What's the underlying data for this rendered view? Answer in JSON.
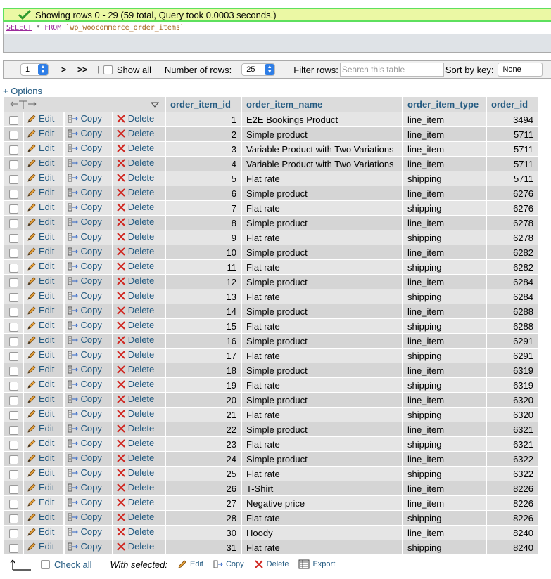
{
  "message": {
    "text": "Showing rows 0 - 29 (59 total, Query took 0.0003 seconds.)",
    "icon": "check-icon",
    "color": "#5ee05e"
  },
  "sql": {
    "select": "SELECT",
    "star": "*",
    "from": "FROM",
    "table": "`wp_woocommerce_order_items`"
  },
  "nav": {
    "page_value": "1",
    "next_label": ">",
    "last_label": ">>",
    "separator": "|",
    "show_all_label": "Show all",
    "rows_label": "Number of rows:",
    "rows_value": "25",
    "filter_label": "Filter rows:",
    "filter_placeholder": "Search this table",
    "sort_label": "Sort by key:",
    "sort_value": "None"
  },
  "options_label": "+ Options",
  "table": {
    "columns": [
      "order_item_id",
      "order_item_name",
      "order_item_type",
      "order_id"
    ],
    "action_labels": {
      "edit": "Edit",
      "copy": "Copy",
      "delete": "Delete"
    },
    "rows": [
      {
        "id": "1",
        "name": "E2E Bookings Product",
        "type": "line_item",
        "order": "3494"
      },
      {
        "id": "2",
        "name": "Simple product",
        "type": "line_item",
        "order": "5711"
      },
      {
        "id": "3",
        "name": "Variable Product with Two Variations",
        "type": "line_item",
        "order": "5711"
      },
      {
        "id": "4",
        "name": "Variable Product with Two Variations",
        "type": "line_item",
        "order": "5711"
      },
      {
        "id": "5",
        "name": "Flat rate",
        "type": "shipping",
        "order": "5711"
      },
      {
        "id": "6",
        "name": "Simple product",
        "type": "line_item",
        "order": "6276"
      },
      {
        "id": "7",
        "name": "Flat rate",
        "type": "shipping",
        "order": "6276"
      },
      {
        "id": "8",
        "name": "Simple product",
        "type": "line_item",
        "order": "6278"
      },
      {
        "id": "9",
        "name": "Flat rate",
        "type": "shipping",
        "order": "6278"
      },
      {
        "id": "10",
        "name": "Simple product",
        "type": "line_item",
        "order": "6282"
      },
      {
        "id": "11",
        "name": "Flat rate",
        "type": "shipping",
        "order": "6282"
      },
      {
        "id": "12",
        "name": "Simple product",
        "type": "line_item",
        "order": "6284"
      },
      {
        "id": "13",
        "name": "Flat rate",
        "type": "shipping",
        "order": "6284"
      },
      {
        "id": "14",
        "name": "Simple product",
        "type": "line_item",
        "order": "6288"
      },
      {
        "id": "15",
        "name": "Flat rate",
        "type": "shipping",
        "order": "6288"
      },
      {
        "id": "16",
        "name": "Simple product",
        "type": "line_item",
        "order": "6291"
      },
      {
        "id": "17",
        "name": "Flat rate",
        "type": "shipping",
        "order": "6291"
      },
      {
        "id": "18",
        "name": "Simple product",
        "type": "line_item",
        "order": "6319"
      },
      {
        "id": "19",
        "name": "Flat rate",
        "type": "shipping",
        "order": "6319"
      },
      {
        "id": "20",
        "name": "Simple product",
        "type": "line_item",
        "order": "6320"
      },
      {
        "id": "21",
        "name": "Flat rate",
        "type": "shipping",
        "order": "6320"
      },
      {
        "id": "22",
        "name": "Simple product",
        "type": "line_item",
        "order": "6321"
      },
      {
        "id": "23",
        "name": "Flat rate",
        "type": "shipping",
        "order": "6321"
      },
      {
        "id": "24",
        "name": "Simple product",
        "type": "line_item",
        "order": "6322"
      },
      {
        "id": "25",
        "name": "Flat rate",
        "type": "shipping",
        "order": "6322"
      },
      {
        "id": "26",
        "name": "T-Shirt",
        "type": "line_item",
        "order": "8226"
      },
      {
        "id": "27",
        "name": "Negative price",
        "type": "line_item",
        "order": "8226"
      },
      {
        "id": "28",
        "name": "Flat rate",
        "type": "shipping",
        "order": "8226"
      },
      {
        "id": "30",
        "name": "Hoody",
        "type": "line_item",
        "order": "8240"
      },
      {
        "id": "31",
        "name": "Flat rate",
        "type": "shipping",
        "order": "8240"
      }
    ]
  },
  "bottom": {
    "check_all_label": "Check all",
    "with_selected_label": "With selected:",
    "edit_label": "Edit",
    "copy_label": "Copy",
    "delete_label": "Delete",
    "export_label": "Export"
  },
  "colors": {
    "link": "#235a81",
    "row_odd": "#e5e5e5",
    "row_even": "#d5d5d5",
    "delete_red": "#d0251f"
  }
}
